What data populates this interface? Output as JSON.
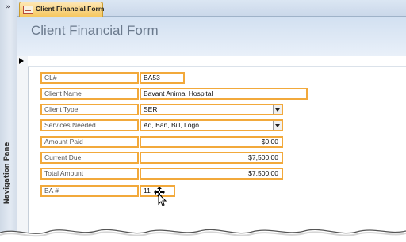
{
  "nav": {
    "toggle": "»",
    "label": "Navigation Pane"
  },
  "tab": {
    "label": "Client Financial Form"
  },
  "form": {
    "title": "Client Financial Form",
    "fields": [
      {
        "label": "CL#",
        "value": "BA53"
      },
      {
        "label": "Client Name",
        "value": "Bavant Animal Hospital"
      },
      {
        "label": "Client Type",
        "value": "SER"
      },
      {
        "label": "Services Needed",
        "value": "Ad, Ban, Bill, Logo"
      },
      {
        "label": "Amount Paid",
        "value": "$0.00"
      },
      {
        "label": "Current Due",
        "value": "$7,500.00"
      },
      {
        "label": "Total Amount",
        "value": "$7,500.00"
      },
      {
        "label": "BA #",
        "value": "11"
      }
    ]
  }
}
